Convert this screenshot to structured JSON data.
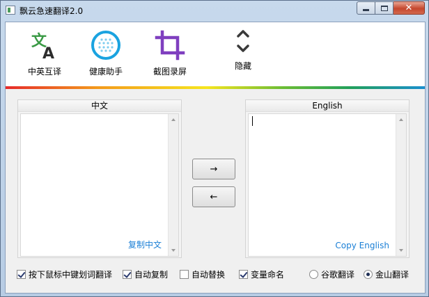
{
  "window": {
    "title": "飘云急速翻译2.0",
    "controls": {
      "minimize": "minimize",
      "maximize": "maximize",
      "close": "✕"
    }
  },
  "toolbar": {
    "items": [
      {
        "label": "中英互译",
        "icon": "translate-icon",
        "color": "#3a9a45"
      },
      {
        "label": "健康助手",
        "icon": "health-grid-icon",
        "color": "#1aa3e0"
      },
      {
        "label": "截图录屏",
        "icon": "crop-icon",
        "color": "#7f3fbf"
      },
      {
        "label": "隐藏",
        "icon": "chevron-up-down-icon",
        "color": "#3a3a3a"
      }
    ]
  },
  "panels": {
    "left": {
      "header": "中文",
      "link": "复制中文",
      "value": ""
    },
    "right": {
      "header": "English",
      "link": "Copy English",
      "value": ""
    }
  },
  "buttons": {
    "to_right": "→",
    "to_left": "←"
  },
  "options": {
    "checkboxes": [
      {
        "label": "按下鼠标中键划词翻译",
        "checked": true
      },
      {
        "label": "自动复制",
        "checked": true
      },
      {
        "label": "自动替换",
        "checked": false
      },
      {
        "label": "变量命名",
        "checked": true
      }
    ],
    "radios": [
      {
        "label": "谷歌翻译",
        "selected": false
      },
      {
        "label": "金山翻译",
        "selected": true
      }
    ]
  },
  "colors": {
    "accent_link": "#1a7fd6",
    "rainbow": [
      "#e62a2a",
      "#f39a1c",
      "#f6e51e",
      "#6cbd34",
      "#22a05a",
      "#1a8fcf"
    ]
  }
}
